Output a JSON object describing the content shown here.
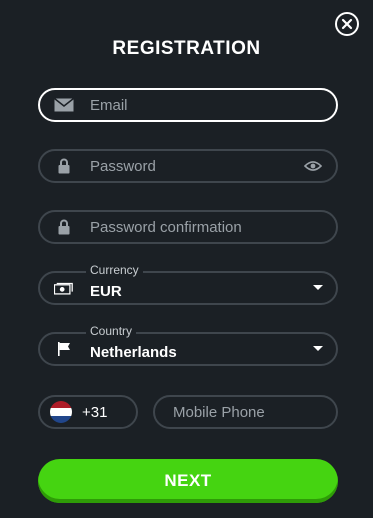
{
  "title": "REGISTRATION",
  "email": {
    "placeholder": "Email",
    "icon": "envelope-icon"
  },
  "password": {
    "placeholder": "Password",
    "icon": "lock-icon",
    "toggle_icon": "eye-icon"
  },
  "password_confirmation": {
    "placeholder": "Password confirmation",
    "icon": "lock-icon"
  },
  "currency": {
    "label": "Currency",
    "value": "EUR",
    "icon": "money-icon"
  },
  "country": {
    "label": "Country",
    "value": "Netherlands",
    "icon": "flag-icon"
  },
  "phone": {
    "code": "+31",
    "placeholder": "Mobile Phone",
    "flag_colors": [
      "#ae1c28",
      "#ffffff",
      "#21468b"
    ]
  },
  "next_label": "NEXT",
  "colors": {
    "background": "#1b2025",
    "button": "#45d411",
    "border": "#3f464d"
  }
}
